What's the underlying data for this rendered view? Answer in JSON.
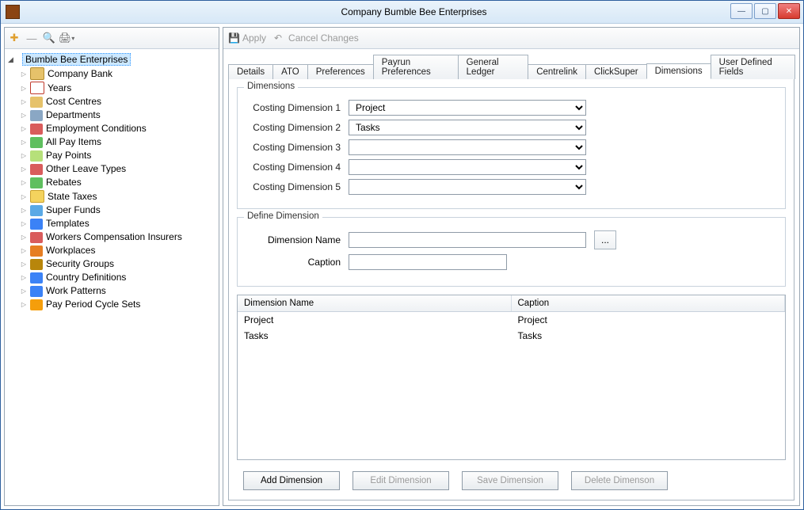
{
  "window": {
    "title": "Company Bumble Bee Enterprises"
  },
  "toolbar": {
    "apply": "Apply",
    "cancel": "Cancel Changes"
  },
  "tree": {
    "root": "Bumble Bee Enterprises",
    "items": [
      {
        "label": "Company Bank",
        "icon": "ic-box"
      },
      {
        "label": "Years",
        "icon": "ic-cal"
      },
      {
        "label": "Cost Centres",
        "icon": "ic-folder"
      },
      {
        "label": "Departments",
        "icon": "ic-gear"
      },
      {
        "label": "Employment Conditions",
        "icon": "ic-red"
      },
      {
        "label": "All Pay Items",
        "icon": "ic-green"
      },
      {
        "label": "Pay Points",
        "icon": "ic-money"
      },
      {
        "label": "Other Leave Types",
        "icon": "ic-red"
      },
      {
        "label": "Rebates",
        "icon": "ic-green"
      },
      {
        "label": "State Taxes",
        "icon": "ic-mail"
      },
      {
        "label": "Super Funds",
        "icon": "ic-shield"
      },
      {
        "label": "Templates",
        "icon": "ic-blueball"
      },
      {
        "label": "Workers Compensation Insurers",
        "icon": "ic-red"
      },
      {
        "label": "Workplaces",
        "icon": "ic-house"
      },
      {
        "label": "Security Groups",
        "icon": "ic-lock"
      },
      {
        "label": "Country Definitions",
        "icon": "ic-blueball"
      },
      {
        "label": "Work Patterns",
        "icon": "ic-person"
      },
      {
        "label": "Pay Period Cycle Sets",
        "icon": "ic-chart"
      }
    ]
  },
  "tabs": [
    "Details",
    "ATO",
    "Preferences",
    "Payrun Preferences",
    "General Ledger",
    "Centrelink",
    "ClickSuper",
    "Dimensions",
    "User Defined Fields"
  ],
  "active_tab": "Dimensions",
  "dimensions": {
    "legend": "Dimensions",
    "rows": [
      {
        "label": "Costing Dimension 1",
        "value": "Project"
      },
      {
        "label": "Costing Dimension 2",
        "value": "Tasks"
      },
      {
        "label": "Costing Dimension 3",
        "value": ""
      },
      {
        "label": "Costing Dimension 4",
        "value": ""
      },
      {
        "label": "Costing Dimension 5",
        "value": ""
      }
    ]
  },
  "define": {
    "legend": "Define Dimension",
    "name_label": "Dimension Name",
    "name_value": "",
    "caption_label": "Caption",
    "caption_value": "",
    "browse": "..."
  },
  "grid": {
    "headers": [
      "Dimension Name",
      "Caption"
    ],
    "rows": [
      {
        "name": "Project",
        "caption": "Project"
      },
      {
        "name": "Tasks",
        "caption": "Tasks"
      }
    ]
  },
  "buttons": {
    "add": "Add Dimension",
    "edit": "Edit Dimension",
    "save": "Save Dimension",
    "delete": "Delete Dimenson"
  }
}
